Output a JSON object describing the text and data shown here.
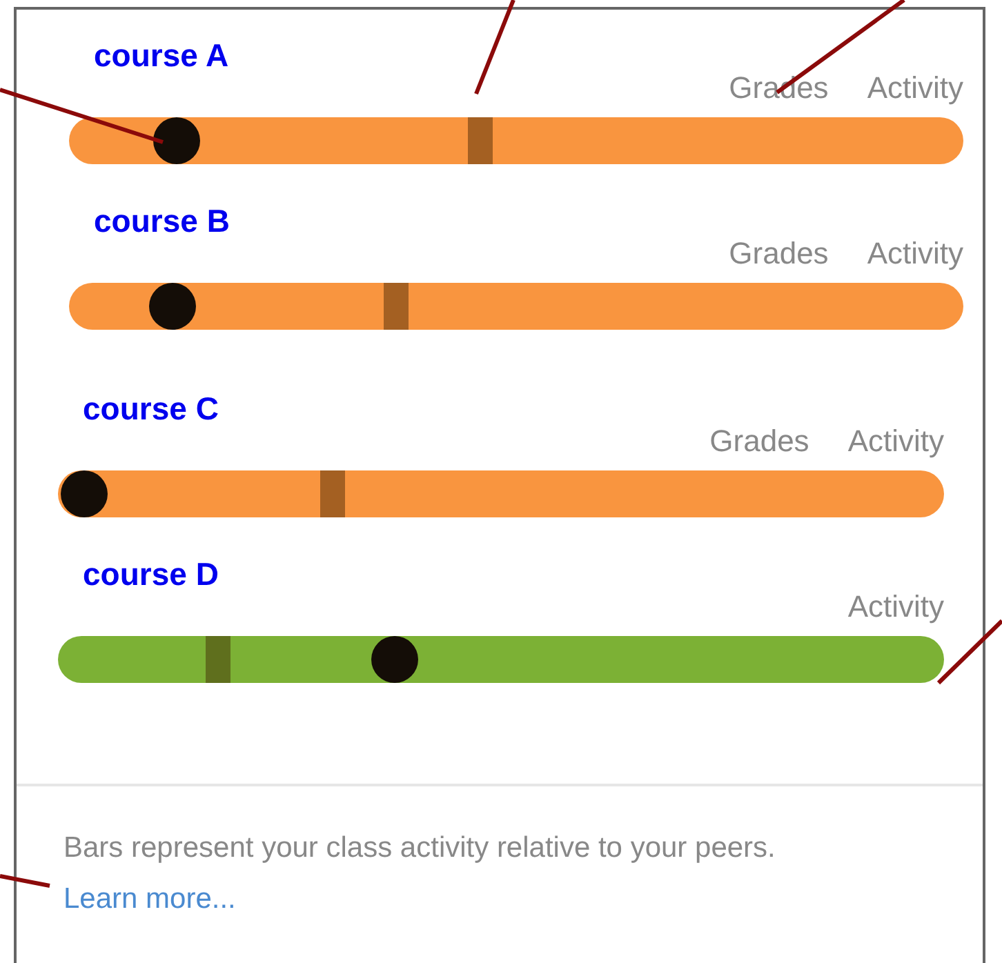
{
  "panels": [
    {
      "courses": [
        {
          "name": "course A",
          "labels": [
            "Grades",
            "Activity"
          ],
          "color": "#f9953f",
          "dot": {
            "level": 0.12
          },
          "marker": {
            "level": 0.46
          }
        },
        {
          "name": "course B",
          "labels": [
            "Grades",
            "Activity"
          ],
          "color": "#f9953f",
          "dot": {
            "level": 0.115
          },
          "marker": {
            "level": 0.365
          }
        }
      ]
    },
    {
      "courses": [
        {
          "name": "course C",
          "labels": [
            "Grades",
            "Activity"
          ],
          "color": "#f9953f",
          "dot": {
            "level": 0.03
          },
          "marker": {
            "level": 0.31
          }
        },
        {
          "name": "course D",
          "labels": [
            "Activity"
          ],
          "color": "#7cb135",
          "dot": {
            "level": 0.38
          },
          "marker": {
            "level": 0.18
          }
        }
      ]
    }
  ],
  "footer": {
    "text": "Bars represent your class activity relative to your peers.",
    "link": "Learn more..."
  }
}
